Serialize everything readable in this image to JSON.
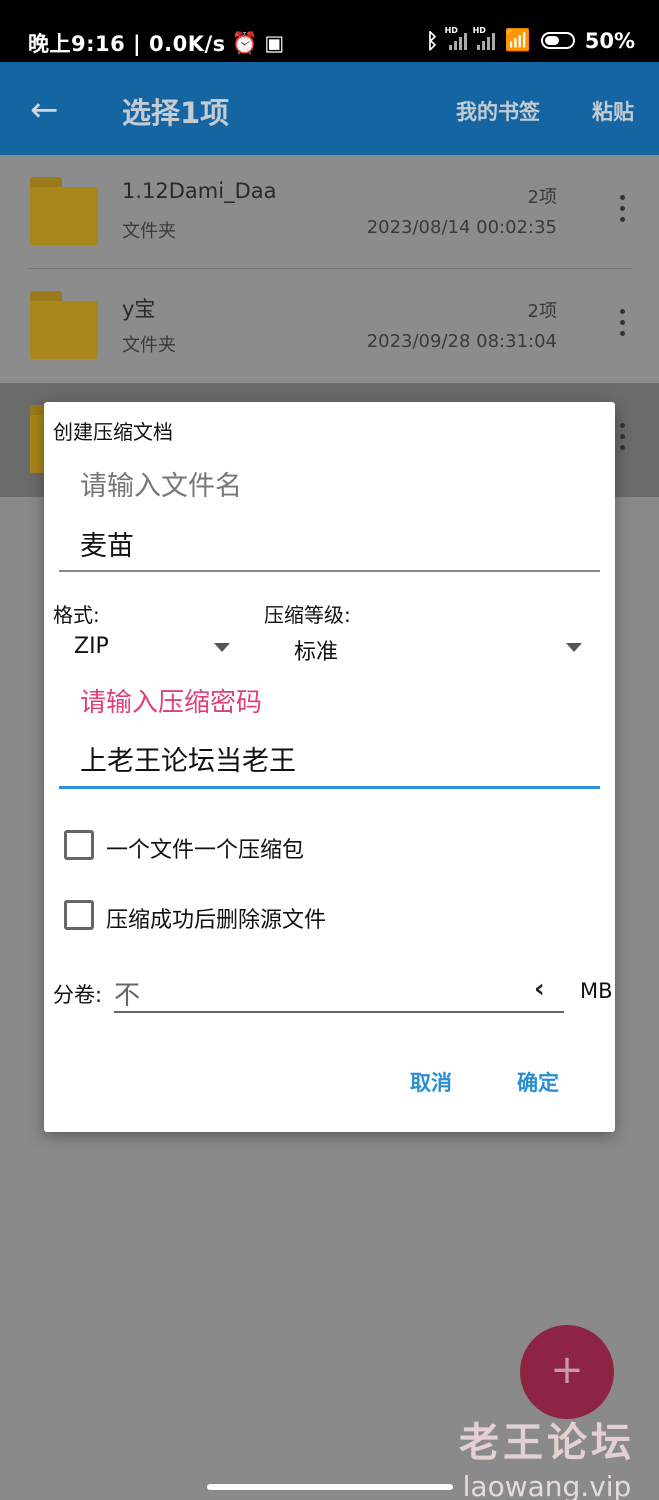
{
  "status_bar": {
    "time": "晚上9:16 | 0.0K/s",
    "battery": "50%"
  },
  "app_bar": {
    "title": "选择1项",
    "bookmarks": "我的书签",
    "paste": "粘贴"
  },
  "files": [
    {
      "name": "1.12Dami_Daa",
      "type": "文件夹",
      "count": "2项",
      "date": "2023/08/14 00:02:35"
    },
    {
      "name": "y宝",
      "type": "文件夹",
      "count": "2项",
      "date": "2023/09/28 08:31:04"
    }
  ],
  "dialog": {
    "title": "创建压缩文档",
    "filename_hint": "请输入文件名",
    "filename": "麦苗",
    "format_label": "格式:",
    "format_value": "ZIP",
    "level_label": "压缩等级:",
    "level_value": "标准",
    "password_label": "请输入压缩密码",
    "password": "上老王论坛当老王",
    "option1": "一个文件一个压缩包",
    "option2": "压缩成功后删除源文件",
    "split_label": "分卷:",
    "split_value": "不",
    "split_unit": "MB",
    "cancel": "取消",
    "ok": "确定"
  },
  "fab": "+",
  "watermark": {
    "line1": "老王论坛",
    "line2": "laowang.vip"
  },
  "colors": {
    "accent": "#2d8fd5",
    "pink": "#e0407a",
    "appbar": "#1565a3"
  }
}
